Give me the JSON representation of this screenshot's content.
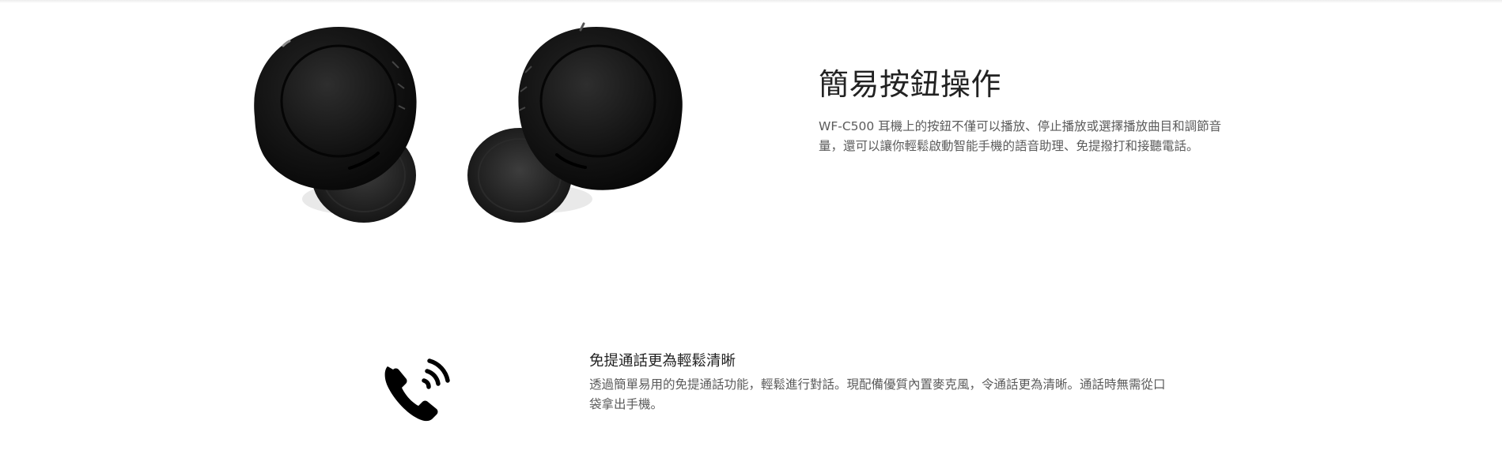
{
  "feature": {
    "title": "簡易按鈕操作",
    "description": "WF-C500 耳機上的按鈕不僅可以播放、停止播放或選擇播放曲目和調節音量，還可以讓你輕鬆啟動智能手機的語音助理、免提撥打和接聽電話。"
  },
  "call_feature": {
    "title": "免提通話更為輕鬆清晰",
    "description": "透過簡單易用的免提通話功能，輕鬆進行對話。現配備優質內置麥克風，令通話更為清晰。通話時無需從口袋拿出手機。"
  },
  "images": {
    "earbuds": "earbuds-product-image",
    "phone": "phone-call-icon"
  },
  "colors": {
    "earbud": "#141414",
    "title": "#222222",
    "body_text": "#5b5b5b"
  }
}
